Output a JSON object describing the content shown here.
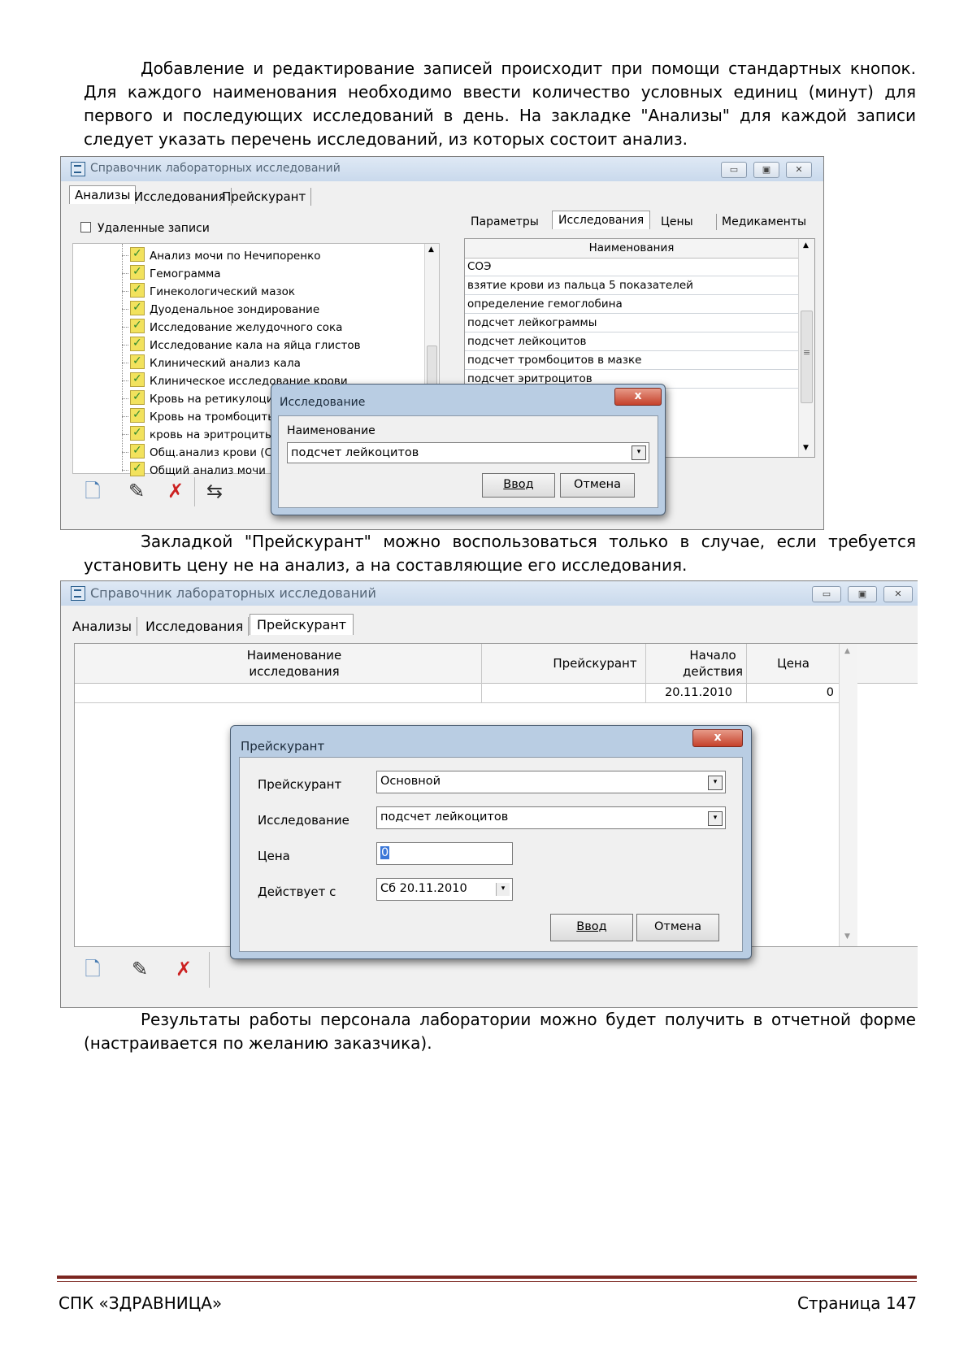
{
  "paragraphs": {
    "p1": "Добавление и редактирование записей происходит при помощи стандартных кнопок. Для каждого наименования необходимо ввести количество условных единиц (минут) для первого и последующих исследований в день. На закладке \"Анализы\" для каждой записи следует указать перечень исследований, из которых состоит анализ.",
    "p2": "Закладкой \"Прейскурант\" можно воспользоваться только в случае, если требуется установить цену не на анализ, а на составляющие его исследования.",
    "p3": "Результаты работы персонала лаборатории можно будет получить в отчетной форме (настраивается по желанию заказчика)."
  },
  "window1": {
    "title": "Справочник лабораторных исследований",
    "tabs": [
      "Анализы",
      "Исследования",
      "Прейскурант"
    ],
    "deleted_checkbox": "Удаленные записи",
    "right_tabs": [
      "Параметры",
      "Исследования",
      "Цены",
      "Медикаменты"
    ],
    "tree_items": [
      "Анализ мочи по Нечипоренко",
      "Гемограмма",
      "Гинекологический мазок",
      "Дуоденальное зондирование",
      "Исследование желудочного сока",
      "Исследование кала на яйца глистов",
      "Клинический анализ кала",
      "Клиническое исследование крови",
      "Кровь на ретикулоцит",
      "Кровь на тромбоциты",
      "кровь на эритроциты",
      "Общ.анализ крови (С",
      "Общий анализ мочи"
    ],
    "grid_header": "Наименования",
    "grid_rows": [
      "СОЭ",
      "взятие крови из пальца 5 показателей",
      "определение гемоглобина",
      "подсчет лейкограммы",
      "подсчет лейкоцитов",
      "подсчет тромбоцитов в мазке",
      "подсчет эритроцитов"
    ],
    "scroll_mark": "≡",
    "dialog": {
      "title": "Исследование",
      "close": "x",
      "label": "Наименование",
      "value": "подсчет лейкоцитов",
      "ok": "Ввод",
      "cancel": "Отмена"
    }
  },
  "window2": {
    "title": "Справочник лабораторных исследований",
    "tabs": [
      "Анализы",
      "Исследования",
      "Прейскурант"
    ],
    "headers": {
      "name_line1": "Наименование",
      "name_line2": "исследования",
      "pricelist": "Прейскурант",
      "start_line1": "Начало",
      "start_line2": "действия",
      "price": "Цена"
    },
    "row": {
      "name": "",
      "pricelist": "",
      "start": "20.11.2010",
      "price": "0"
    },
    "dialog": {
      "title": "Прейскурант",
      "close": "x",
      "pricelist_label": "Прейскурант",
      "pricelist_value": "Основной",
      "study_label": "Исследование",
      "study_value": "подсчет лейкоцитов",
      "price_label": "Цена",
      "price_value": "0",
      "date_label": "Действует с",
      "date_value": "Сб  20.11.2010",
      "ok": "Ввод",
      "cancel": "Отмена"
    }
  },
  "footer": {
    "left": "СПК «ЗДРАВНИЦА»",
    "right": "Страница 147"
  }
}
